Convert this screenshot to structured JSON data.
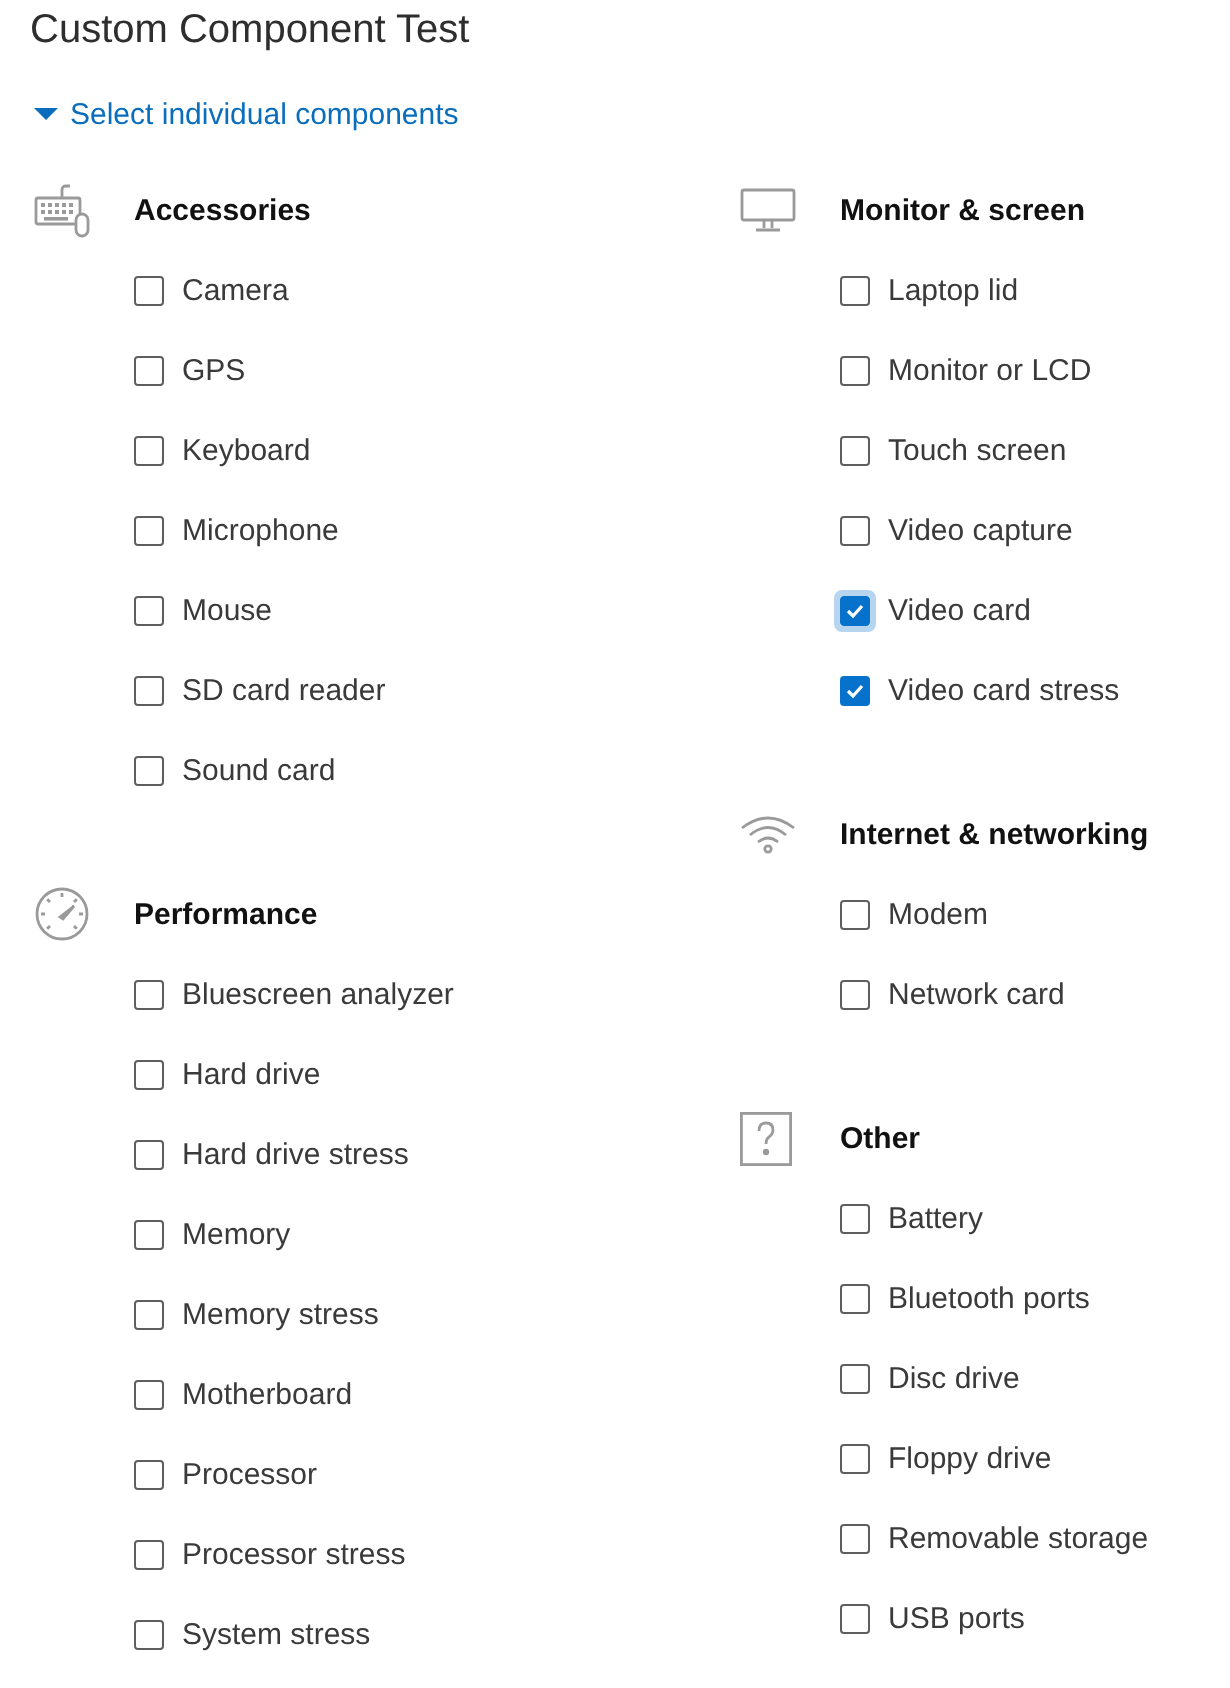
{
  "title": "Custom Component Test",
  "disclosure": {
    "label": "Select individual components",
    "expanded": true
  },
  "columns": [
    {
      "sections": [
        {
          "heading": "Accessories",
          "items": [
            {
              "label": "Camera",
              "checked": false,
              "focused": false
            },
            {
              "label": "GPS",
              "checked": false,
              "focused": false
            },
            {
              "label": "Keyboard",
              "checked": false,
              "focused": false
            },
            {
              "label": "Microphone",
              "checked": false,
              "focused": false
            },
            {
              "label": "Mouse",
              "checked": false,
              "focused": false
            },
            {
              "label": "SD card reader",
              "checked": false,
              "focused": false
            },
            {
              "label": "Sound card",
              "checked": false,
              "focused": false
            }
          ]
        },
        {
          "heading": "Performance",
          "items": [
            {
              "label": "Bluescreen analyzer",
              "checked": false,
              "focused": false
            },
            {
              "label": "Hard drive",
              "checked": false,
              "focused": false
            },
            {
              "label": "Hard drive stress",
              "checked": false,
              "focused": false
            },
            {
              "label": "Memory",
              "checked": false,
              "focused": false
            },
            {
              "label": "Memory stress",
              "checked": false,
              "focused": false
            },
            {
              "label": "Motherboard",
              "checked": false,
              "focused": false
            },
            {
              "label": "Processor",
              "checked": false,
              "focused": false
            },
            {
              "label": "Processor stress",
              "checked": false,
              "focused": false
            },
            {
              "label": "System stress",
              "checked": false,
              "focused": false
            }
          ]
        }
      ]
    },
    {
      "sections": [
        {
          "heading": "Monitor & screen",
          "items": [
            {
              "label": "Laptop lid",
              "checked": false,
              "focused": false
            },
            {
              "label": "Monitor or LCD",
              "checked": false,
              "focused": false
            },
            {
              "label": "Touch screen",
              "checked": false,
              "focused": false
            },
            {
              "label": "Video capture",
              "checked": false,
              "focused": false
            },
            {
              "label": "Video card",
              "checked": true,
              "focused": true
            },
            {
              "label": "Video card stress",
              "checked": true,
              "focused": false
            }
          ]
        },
        {
          "heading": "Internet & networking",
          "items": [
            {
              "label": "Modem",
              "checked": false,
              "focused": false
            },
            {
              "label": "Network card",
              "checked": false,
              "focused": false
            }
          ]
        },
        {
          "heading": "Other",
          "items": [
            {
              "label": "Battery",
              "checked": false,
              "focused": false
            },
            {
              "label": "Bluetooth ports",
              "checked": false,
              "focused": false
            },
            {
              "label": "Disc drive",
              "checked": false,
              "focused": false
            },
            {
              "label": "Floppy drive",
              "checked": false,
              "focused": false
            },
            {
              "label": "Removable storage",
              "checked": false,
              "focused": false
            },
            {
              "label": "USB ports",
              "checked": false,
              "focused": false
            }
          ]
        }
      ]
    }
  ]
}
